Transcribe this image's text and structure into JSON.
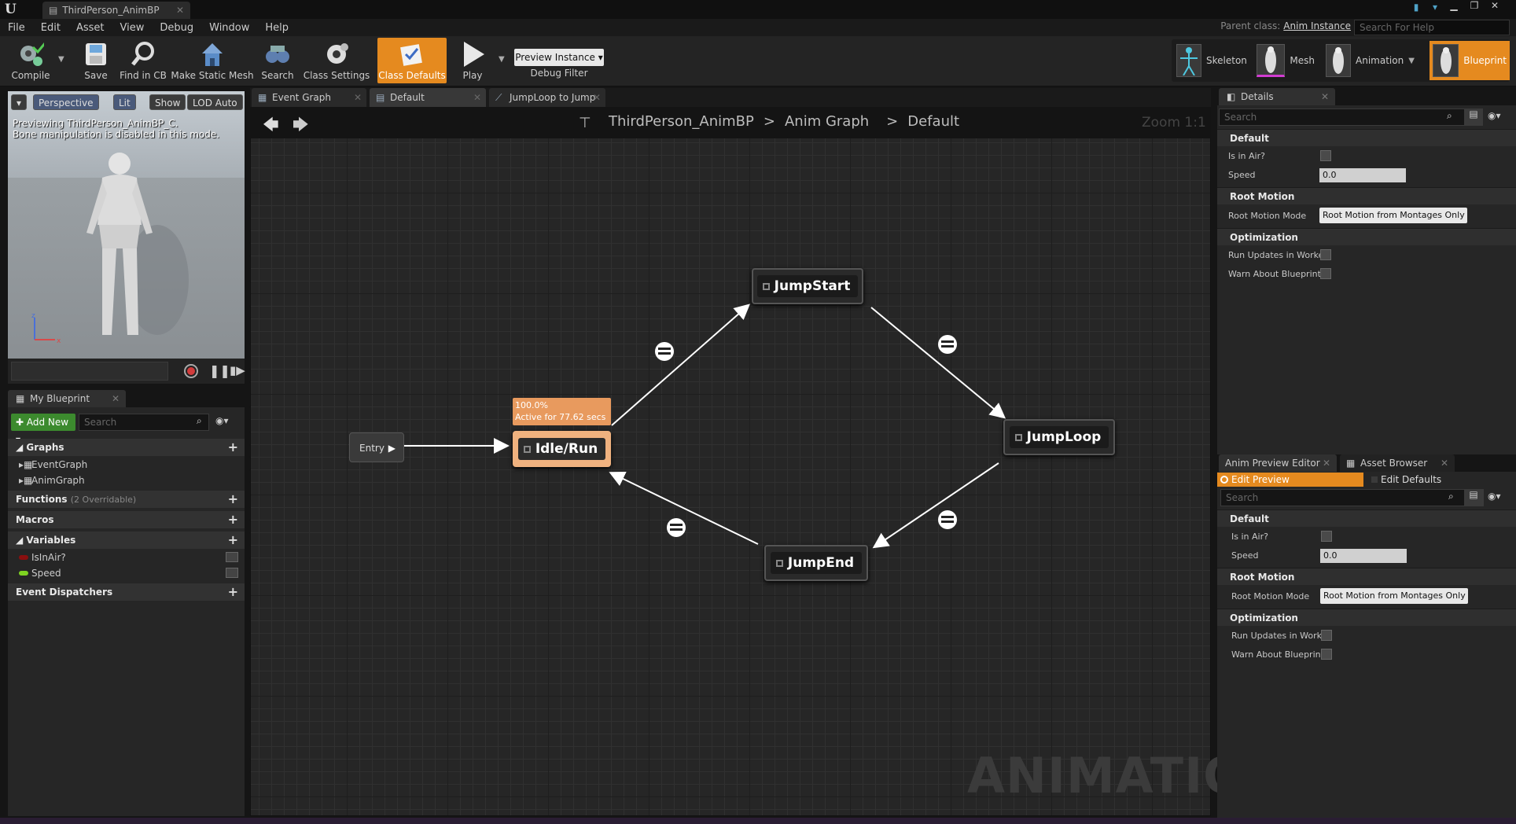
{
  "window": {
    "tab_title": "ThirdPerson_AnimBP",
    "logo": "U"
  },
  "menu": [
    "File",
    "Edit",
    "Asset",
    "View",
    "Debug",
    "Window",
    "Help"
  ],
  "parent_class": {
    "label": "Parent class:",
    "value": "Anim Instance"
  },
  "help_search": {
    "placeholder": "Search For Help"
  },
  "toolbar": {
    "compile": "Compile",
    "save": "Save",
    "find_in_cb": "Find in CB",
    "make_static_mesh": "Make Static Mesh",
    "search": "Search",
    "class_settings": "Class Settings",
    "class_defaults": "Class Defaults",
    "play": "Play",
    "preview_instance": "Preview Instance",
    "debug_filter": "Debug Filter"
  },
  "modes": {
    "skeleton": "Skeleton",
    "mesh": "Mesh",
    "animation": "Animation",
    "blueprint": "Blueprint"
  },
  "viewport": {
    "perspective": "Perspective",
    "lit": "Lit",
    "show": "Show",
    "lod": "LOD Auto",
    "msg1": "Previewing ThirdPerson_AnimBP_C.",
    "msg2": "Bone manipulation is disabled in this mode."
  },
  "my_blueprint": {
    "tab": "My Blueprint",
    "add_new": "Add New",
    "search_placeholder": "Search",
    "graphs": "Graphs",
    "event_graph": "EventGraph",
    "anim_graph": "AnimGraph",
    "functions": "Functions",
    "functions_note": "(2 Overridable)",
    "macros": "Macros",
    "variables": "Variables",
    "var1": "IsInAir?",
    "var2": "Speed",
    "event_dispatchers": "Event Dispatchers"
  },
  "graph_tabs": [
    "Event Graph",
    "Default",
    "JumpLoop to Jump"
  ],
  "breadcrumb": {
    "root": "ThirdPerson_AnimBP",
    "sep1": ">",
    "mid": "Anim Graph",
    "sep2": ">",
    "leaf": "Default"
  },
  "zoom": "Zoom 1:1",
  "watermark": "ANIMATION",
  "state_machine": {
    "entry": "Entry",
    "states": {
      "jumpstart": "JumpStart",
      "idle": "Idle/Run",
      "jumploop": "JumpLoop",
      "jumpend": "JumpEnd"
    },
    "active_pct": "100.0%",
    "active_time": "Active for 77.62 secs"
  },
  "details": {
    "tab": "Details",
    "search": "Search",
    "default": "Default",
    "is_in_air": "Is in Air?",
    "speed": "Speed",
    "speed_value": "0.0",
    "root_motion": "Root Motion",
    "root_motion_mode": "Root Motion Mode",
    "root_motion_value": "Root Motion from Montages Only",
    "optimization": "Optimization",
    "run_updates": "Run Updates in Worke",
    "warn_bp": "Warn About Blueprint"
  },
  "anim_preview": {
    "tab1": "Anim Preview Editor",
    "tab2": "Asset Browser",
    "edit_preview": "Edit Preview",
    "edit_defaults": "Edit Defaults"
  },
  "colors": {
    "accent": "#e58a1f",
    "active_state": "#f0b27f",
    "var_bool": "#8a0f0f",
    "var_float": "#7ed321"
  }
}
